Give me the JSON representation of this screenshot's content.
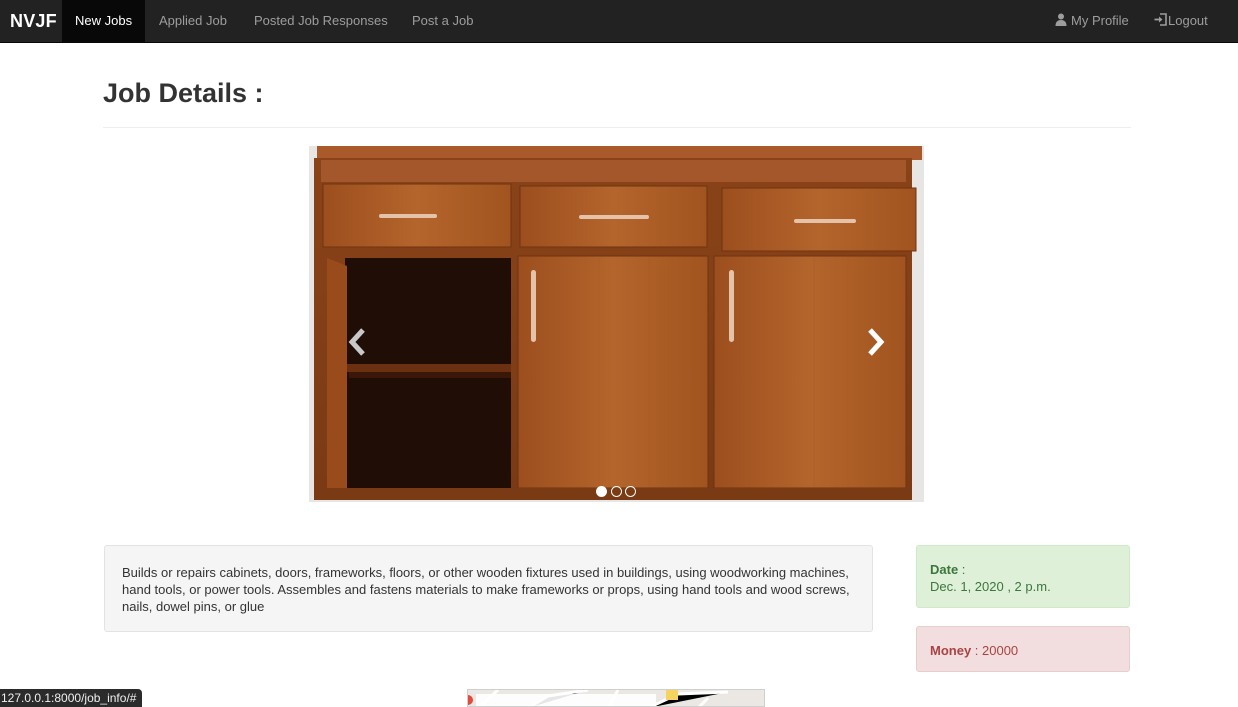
{
  "navbar": {
    "brand": "NVJF",
    "items": [
      {
        "label": "New Jobs",
        "active": true
      },
      {
        "label": "Applied Job",
        "active": false
      },
      {
        "label": "Posted Job Responses",
        "active": false
      },
      {
        "label": "Post a Job",
        "active": false
      }
    ],
    "right_items": [
      {
        "label": "My Profile",
        "icon": "user-icon"
      },
      {
        "label": "Logout",
        "icon": "login-icon"
      }
    ]
  },
  "page": {
    "title": "Job Details :"
  },
  "carousel": {
    "image": "wooden-cabinet",
    "slide_count": 3,
    "active_slide": 1
  },
  "job": {
    "description": "Builds or repairs cabinets, doors, frameworks, floors, or other wooden fixtures used in buildings, using woodworking machines, hand tools, or power tools. Assembles and fastens materials to make frameworks or props, using hand tools and wood screws, nails, dowel pins, or glue",
    "date_label": "Date",
    "date_sep": " :",
    "date_value": "Dec. 1, 2020 , 2 p.m.",
    "money_label": "Money",
    "money_value": " : 20000"
  },
  "status_bar": {
    "url": "127.0.0.1:8000/job_info/#"
  },
  "colors": {
    "navbar_bg": "#222222",
    "success_bg": "#dff0d8",
    "success_text": "#3c763d",
    "danger_bg": "#f2dede",
    "danger_text": "#a94442"
  }
}
